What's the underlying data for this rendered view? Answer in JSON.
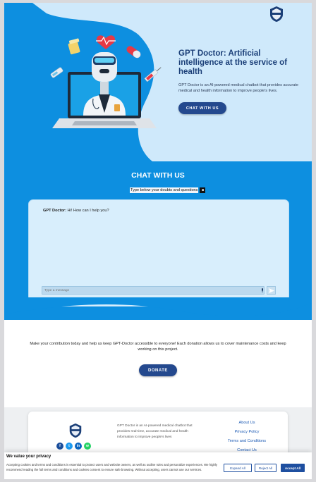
{
  "hero": {
    "title": "GPT Doctor: Artificial intelligence at the service of health",
    "description": "GPT Doctor is an AI-powered medical chatbot that provides accurate medical and health information to improve people's lives.",
    "cta_label": "CHAT WITH US"
  },
  "chat": {
    "title": "CHAT WITH US",
    "subtitle": "Type below your doubts and questions",
    "first_message": {
      "sender": "GPT Doctor:",
      "text": "Hi! How can I help you?"
    },
    "input_placeholder": "Type a message"
  },
  "donate": {
    "text": "Make your contribution today and help us keep GPT-Doctor accessible to everyone! Each donation allows us to cover maintenance costs and keep working on this project.",
    "button_label": "DONATE"
  },
  "footer": {
    "description": "GPT Doctor is an AI-powered medical chatbot that provides real-time, accurate medical and health information to improve people's lives",
    "links": [
      "About Us",
      "Privacy Policy",
      "Terms and Conditions",
      "Contact Us"
    ],
    "socials": [
      {
        "name": "facebook-icon",
        "glyph": "f",
        "color": "#1b4f9c"
      },
      {
        "name": "twitter-icon",
        "glyph": "t",
        "color": "#1d9bf0"
      },
      {
        "name": "linkedin-icon",
        "glyph": "in",
        "color": "#0a66c2"
      },
      {
        "name": "whatsapp-icon",
        "glyph": "w",
        "color": "#25d366"
      }
    ]
  },
  "cookie": {
    "title": "We value your privacy",
    "text": "Accepting cookies and terms and conditions is essential to protect users and website owners, as well as outline rules and personalize experiences. We highly recommend reading the full terms and conditions and cookies consent to ensure safe browsing. Without accepting, users cannot use our services.",
    "expand_label": "Expand All",
    "reject_label": "Reject All",
    "accept_label": "Accept All"
  },
  "colors": {
    "primary_blue": "#0d8fe0",
    "light_blue": "#cfe9fb",
    "navy": "#24498e",
    "link": "#1c5ab4"
  }
}
